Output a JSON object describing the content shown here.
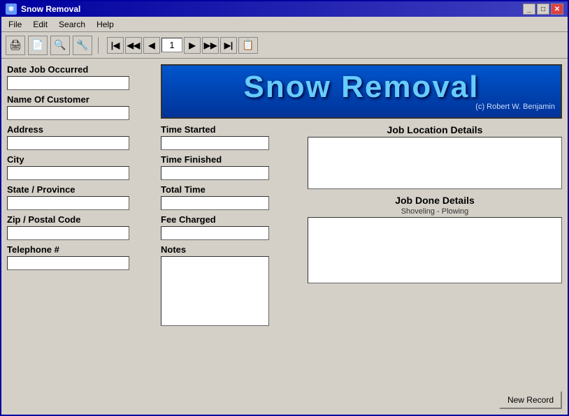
{
  "window": {
    "title": "Snow Removal",
    "icon": "❄"
  },
  "title_controls": {
    "minimize": "_",
    "maximize": "□",
    "close": "✕"
  },
  "menu": {
    "items": [
      "File",
      "Edit",
      "Search",
      "Help"
    ]
  },
  "toolbar": {
    "buttons": [
      "🖨",
      "📄",
      "🔍",
      "🔧"
    ],
    "page_number": "1",
    "nav_first": "⏮",
    "nav_prev_prev": "◀◀",
    "nav_prev": "◀",
    "nav_next": "▶",
    "nav_next_next": "▶▶",
    "nav_last": "⏭",
    "nav_report": "📋"
  },
  "logo": {
    "title": "Snow Removal",
    "subtitle": "(c) Robert W. Benjamin"
  },
  "left_panel": {
    "fields": [
      {
        "label": "Date Job Occurred",
        "id": "date-job",
        "value": ""
      },
      {
        "label": "Name Of Customer",
        "id": "customer-name",
        "value": ""
      },
      {
        "label": "Address",
        "id": "address",
        "value": ""
      },
      {
        "label": "City",
        "id": "city",
        "value": ""
      },
      {
        "label": "State / Province",
        "id": "state",
        "value": ""
      },
      {
        "label": "Zip / Postal Code",
        "id": "zip",
        "value": ""
      },
      {
        "label": "Telephone #",
        "id": "phone",
        "value": ""
      }
    ]
  },
  "middle_panel": {
    "fields": [
      {
        "label": "Time Started",
        "id": "time-started",
        "value": ""
      },
      {
        "label": "Time Finished",
        "id": "time-finished",
        "value": ""
      },
      {
        "label": "Total Time",
        "id": "total-time",
        "value": ""
      },
      {
        "label": "Fee Charged",
        "id": "fee-charged",
        "value": ""
      }
    ],
    "notes_label": "Notes",
    "notes_placeholder": ""
  },
  "right_panel": {
    "job_location_label": "Job Location Details",
    "job_done_label": "Job Done Details",
    "job_done_subtitle": "Shoveling - Plowing"
  },
  "buttons": {
    "new_record": "New Record"
  }
}
